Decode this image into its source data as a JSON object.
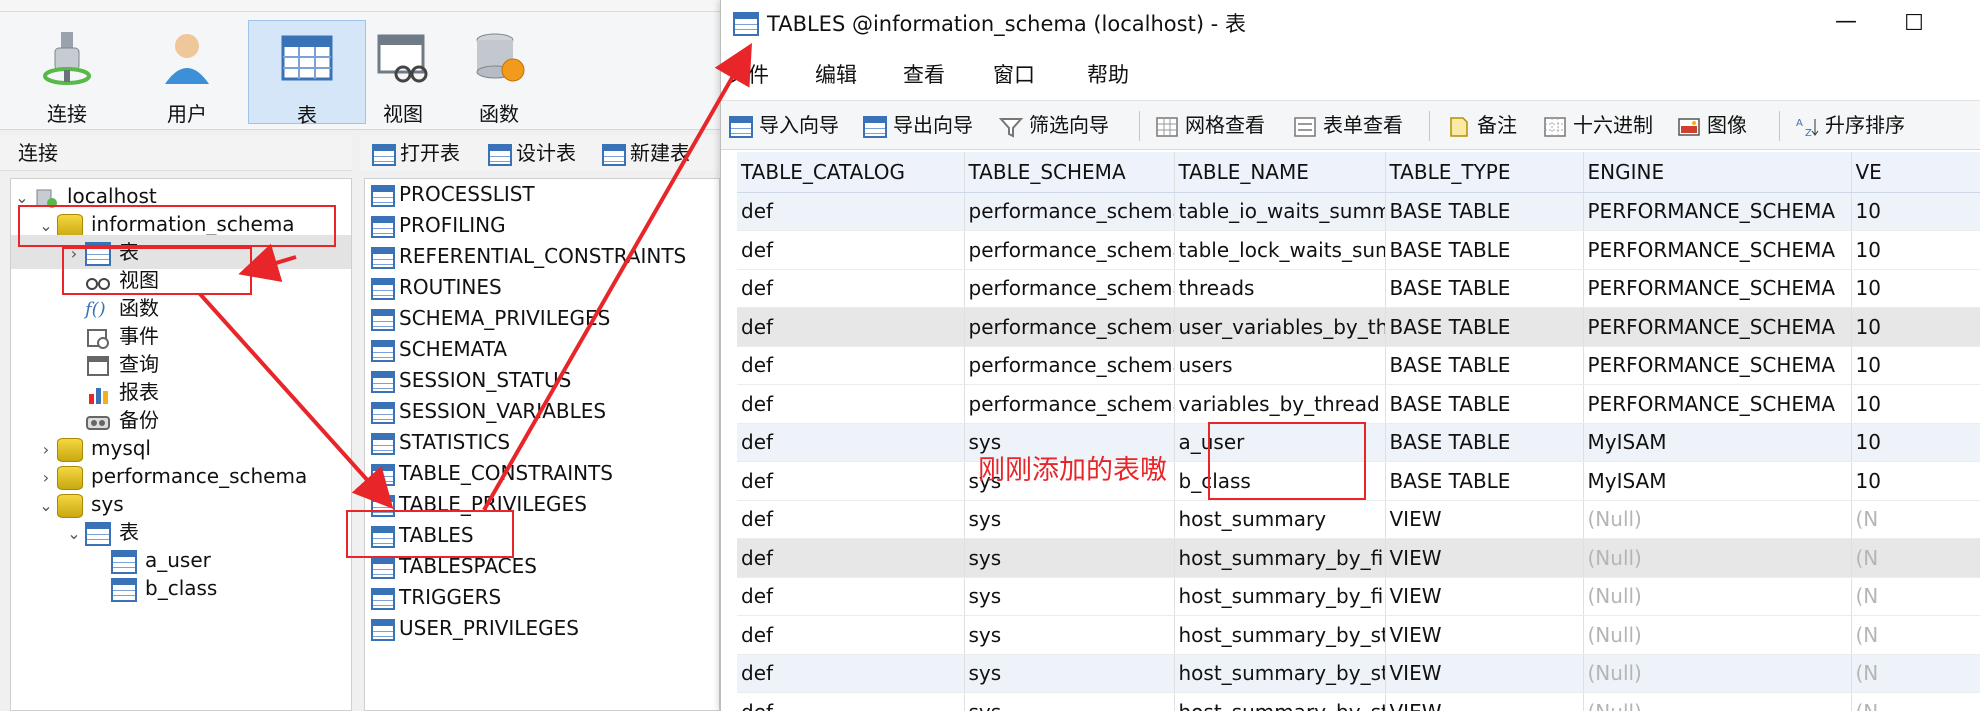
{
  "main": {
    "toolbar": [
      {
        "label": "连接",
        "icon": "plug-icon"
      },
      {
        "label": "用户",
        "icon": "user-icon"
      },
      {
        "label": "表",
        "icon": "table-icon"
      },
      {
        "label": "视图",
        "icon": "view-icon"
      },
      {
        "label": "函数",
        "icon": "function-icon"
      }
    ],
    "connection_header": "连接",
    "tree": [
      {
        "label": "localhost",
        "type": "server"
      },
      {
        "label": "information_schema",
        "type": "database"
      },
      {
        "label": "表",
        "type": "tables"
      },
      {
        "label": "视图",
        "type": "views"
      },
      {
        "label": "函数",
        "type": "functions"
      },
      {
        "label": "事件",
        "type": "events"
      },
      {
        "label": "查询",
        "type": "queries"
      },
      {
        "label": "报表",
        "type": "reports"
      },
      {
        "label": "备份",
        "type": "backups"
      },
      {
        "label": "mysql",
        "type": "database"
      },
      {
        "label": "performance_schema",
        "type": "database"
      },
      {
        "label": "sys",
        "type": "database"
      },
      {
        "label": "表",
        "type": "tables"
      },
      {
        "label": "a_user",
        "type": "table"
      },
      {
        "label": "b_class",
        "type": "table"
      }
    ],
    "object_toolbar": [
      "打开表",
      "设计表",
      "新建表"
    ],
    "objects": [
      "PROCESSLIST",
      "PROFILING",
      "REFERENTIAL_CONSTRAINTS",
      "ROUTINES",
      "SCHEMA_PRIVILEGES",
      "SCHEMATA",
      "SESSION_STATUS",
      "SESSION_VARIABLES",
      "STATISTICS",
      "TABLE_CONSTRAINTS",
      "TABLE_PRIVILEGES",
      "TABLES",
      "TABLESPACES",
      "TRIGGERS",
      "USER_PRIVILEGES"
    ]
  },
  "window": {
    "title": "TABLES @information_schema (localhost) - 表",
    "minimize": "—",
    "maximize": "☐"
  },
  "menu": [
    "文件",
    "编辑",
    "查看",
    "窗口",
    "帮助"
  ],
  "viewer_toolbar": [
    "导入向导",
    "导出向导",
    "筛选向导",
    "网格查看",
    "表单查看",
    "备注",
    "十六进制",
    "图像",
    "升序排序"
  ],
  "grid": {
    "columns": [
      "TABLE_CATALOG",
      "TABLE_SCHEMA",
      "TABLE_NAME",
      "TABLE_TYPE",
      "ENGINE",
      "VE"
    ],
    "rows": [
      [
        "def",
        "performance_schema",
        "table_io_waits_summary_b",
        "BASE TABLE",
        "PERFORMANCE_SCHEMA",
        "10"
      ],
      [
        "def",
        "performance_schema",
        "table_lock_waits_summary",
        "BASE TABLE",
        "PERFORMANCE_SCHEMA",
        "10"
      ],
      [
        "def",
        "performance_schema",
        "threads",
        "BASE TABLE",
        "PERFORMANCE_SCHEMA",
        "10"
      ],
      [
        "def",
        "performance_schema",
        "user_variables_by_thread",
        "BASE TABLE",
        "PERFORMANCE_SCHEMA",
        "10"
      ],
      [
        "def",
        "performance_schema",
        "users",
        "BASE TABLE",
        "PERFORMANCE_SCHEMA",
        "10"
      ],
      [
        "def",
        "performance_schema",
        "variables_by_thread",
        "BASE TABLE",
        "PERFORMANCE_SCHEMA",
        "10"
      ],
      [
        "def",
        "sys",
        "a_user",
        "BASE TABLE",
        "MyISAM",
        "10"
      ],
      [
        "def",
        "sys",
        "b_class",
        "BASE TABLE",
        "MyISAM",
        "10"
      ],
      [
        "def",
        "sys",
        "host_summary",
        "VIEW",
        "(Null)",
        "(N"
      ],
      [
        "def",
        "sys",
        "host_summary_by_file_io",
        "VIEW",
        "(Null)",
        "(N"
      ],
      [
        "def",
        "sys",
        "host_summary_by_file_io_t",
        "VIEW",
        "(Null)",
        "(N"
      ],
      [
        "def",
        "sys",
        "host_summary_by_stages",
        "VIEW",
        "(Null)",
        "(N"
      ],
      [
        "def",
        "sys",
        "host_summary_by_statem",
        "VIEW",
        "(Null)",
        "(N"
      ],
      [
        "def",
        "sys",
        "host_summary_by_statem",
        "VIEW",
        "(Null)",
        "(N"
      ]
    ]
  },
  "annotation": {
    "note": "刚刚添加的表嗷",
    "color": "#e8262a"
  },
  "colors": {
    "accent": "#3a72b8",
    "selected_button": "#d4e6f7",
    "row_alt": "#eef3f9"
  }
}
